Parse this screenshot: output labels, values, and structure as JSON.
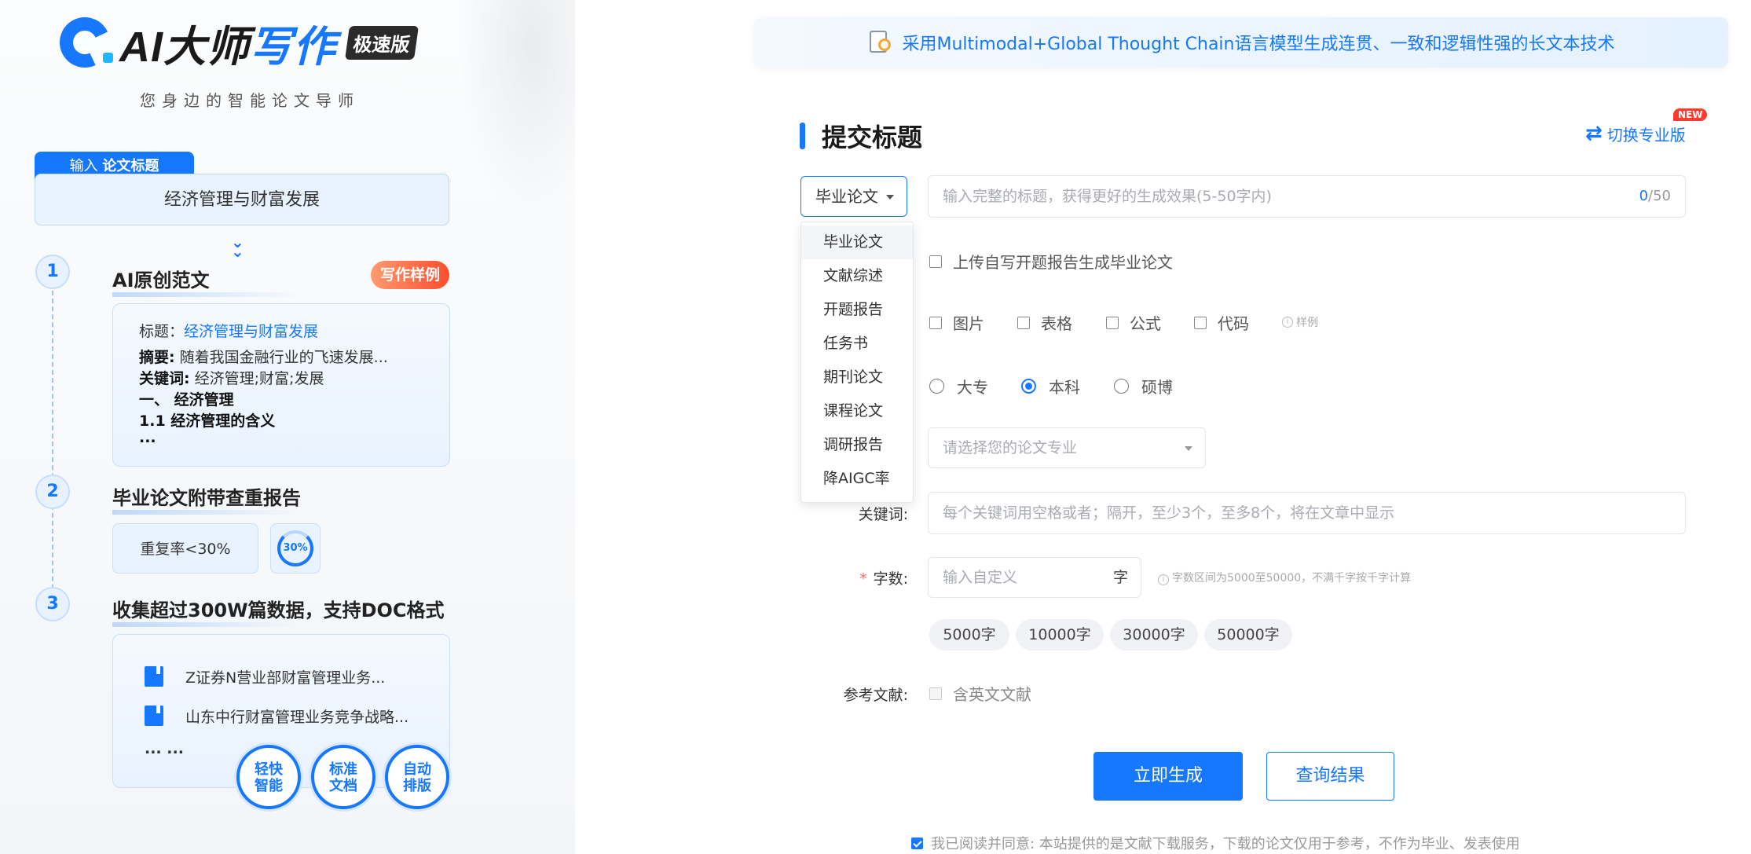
{
  "colors": {
    "accent": "#1677ff",
    "badge": "#ff4d2e",
    "required": "#f56c6c"
  },
  "left": {
    "logo": {
      "ai": "AI大师",
      "xz": "写作",
      "badge": "极速版"
    },
    "slogan": "您身边的智能论文导师",
    "input_tab": {
      "prefix": "输入",
      "strong": "论文标题"
    },
    "title_value": "经济管理与财富发展",
    "steps": [
      {
        "num": "1",
        "title": "AI原创范文"
      },
      {
        "num": "2",
        "title": "毕业论文附带查重报告"
      },
      {
        "num": "3",
        "title": "收集超过300W篇数据，支持DOC格式"
      }
    ],
    "sample_badge": "写作样例",
    "card1": {
      "title_label": "标题：",
      "title_value": "经济管理与财富发展",
      "abstract_label": "摘要:",
      "abstract_value": " 随着我国金融行业的飞速发展...",
      "keyword_label": "关键词:",
      "keyword_value": " 经济管理;财富;发展",
      "heading1": "一、 经济管理",
      "heading2": "1.1 经济管理的含义",
      "more": "..."
    },
    "rate_text": "重复率<30%",
    "rate_ring": "30%",
    "docs": [
      "Z证券N营业部财富管理业务...",
      "山东中行财富管理业务竞争战略..."
    ],
    "docs_more": "... ...",
    "features": [
      {
        "line1": "轻快",
        "line2": "智能"
      },
      {
        "line1": "标准",
        "line2": "文档"
      },
      {
        "line1": "自动",
        "line2": "排版"
      }
    ]
  },
  "right": {
    "banner": "采用Multimodal+Global Thought Chain语言模型生成连贯、一致和逻辑性强的长文本技术",
    "section_title": "提交标题",
    "switch_label": "切换专业版",
    "new_badge": "NEW",
    "type_selected": "毕业论文",
    "title_placeholder": "输入完整的标题，获得更好的生成效果(5-50字内)",
    "title_count_current": "0",
    "title_count_max": "/50",
    "dropdown_options": [
      "毕业论文",
      "文献综述",
      "开题报告",
      "任务书",
      "期刊论文",
      "课程论文",
      "调研报告",
      "降AIGC率"
    ],
    "upload_label": "上传自写开题报告生成毕业论文",
    "extras": [
      "图片",
      "表格",
      "公式",
      "代码"
    ],
    "extras_hint": "样例",
    "levels": [
      "大专",
      "本科",
      "硕博"
    ],
    "level_selected": "本科",
    "major_placeholder": "请选择您的论文专业",
    "keyword_label": "关键词:",
    "keyword_placeholder": "每个关键词用空格或者；隔开，至少3个，至多8个，将在文章中显示",
    "wordcount_required": "*",
    "wordcount_label": "字数:",
    "wordcount_placeholder": "输入自定义",
    "wordcount_unit": "字",
    "wordcount_hint": "字数区间为5000至50000，不满千字按千字计算",
    "wordcount_chips": [
      "5000字",
      "10000字",
      "30000字",
      "50000字"
    ],
    "reference_label": "参考文献:",
    "reference_option": "含英文文献",
    "generate_button": "立即生成",
    "query_button": "查询结果",
    "agreement": "我已阅读并同意: 本站提供的是文献下载服务，下载的论文仅用于参考，不作为毕业、发表使用"
  }
}
